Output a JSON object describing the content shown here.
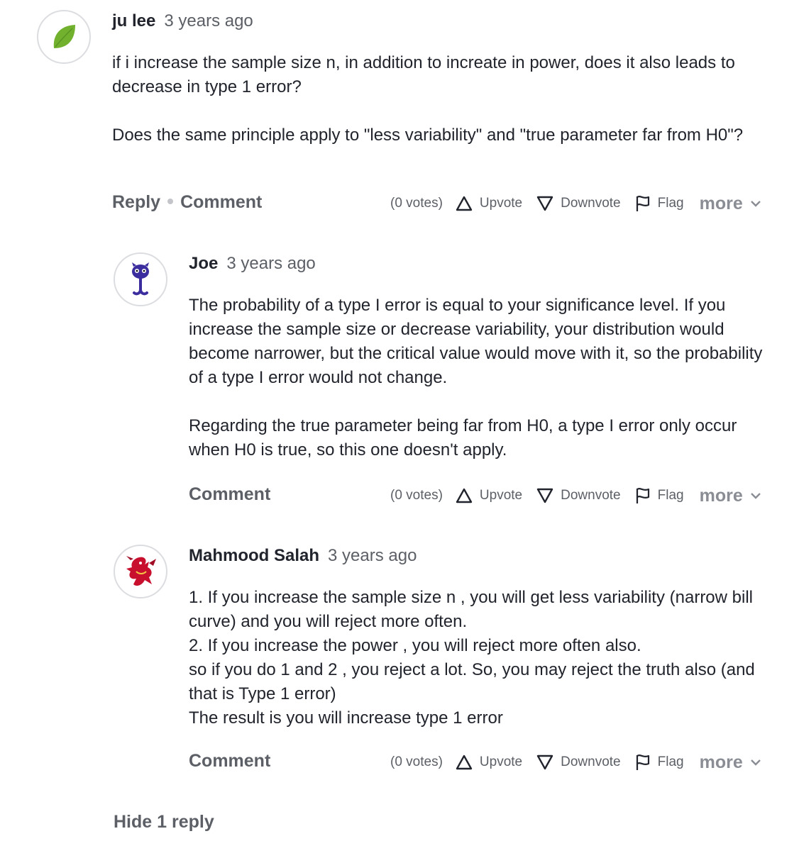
{
  "comments": [
    {
      "author": "ju lee",
      "time": "3 years ago",
      "paragraphs": [
        "if i increase the sample size n, in addition to increate in power, does it also leads to decrease in type 1 error?",
        "Does the same principle apply to \"less variability\" and \"true parameter far from H0\"?"
      ],
      "reply_label": "Reply",
      "comment_label": "Comment",
      "votes": "(0 votes)",
      "upvote": "Upvote",
      "downvote": "Downvote",
      "flag": "Flag",
      "more": "more",
      "avatar_icon": "leaf-icon"
    },
    {
      "author": "Joe",
      "time": "3 years ago",
      "paragraphs": [
        "The probability of a type I error is equal to your significance level. If you increase the sample size or decrease variability, your distribution would become narrower, but the critical value would move with it, so the probability of a type I error would not change.",
        "Regarding the true parameter being far from H0, a type I error only occur when H0 is true, so this one doesn't apply."
      ],
      "comment_label": "Comment",
      "votes": "(0 votes)",
      "upvote": "Upvote",
      "downvote": "Downvote",
      "flag": "Flag",
      "more": "more",
      "avatar_icon": "purple-creature-icon"
    },
    {
      "author": "Mahmood Salah",
      "time": "3 years ago",
      "lines": [
        "1. If you increase the sample size n , you will get less variability (narrow bill curve) and you will reject more often.",
        "2. If you increase the power , you will reject more often also.",
        "so if you do 1 and 2 , you reject a lot. So, you may reject the truth also (and that is Type 1 error)",
        "The result is you will increase type 1 error"
      ],
      "comment_label": "Comment",
      "votes": "(0 votes)",
      "upvote": "Upvote",
      "downvote": "Downvote",
      "flag": "Flag",
      "more": "more",
      "avatar_icon": "red-dragon-icon"
    }
  ],
  "hide_replies": "Hide 1 reply",
  "colors": {
    "text": "#21242c",
    "muted": "#5c6066",
    "light": "#8a8d94",
    "leaf": "#72b12e",
    "creature": "#3b2d9e",
    "dragon": "#c8102e"
  }
}
